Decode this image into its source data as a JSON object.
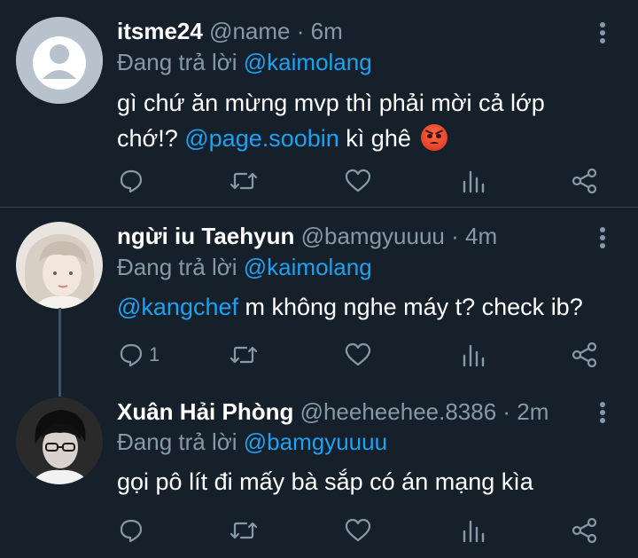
{
  "tweets": [
    {
      "display_name": "itsme24",
      "handle": "@name",
      "time": " · 6m",
      "reply_prefix": "Đang trả lời ",
      "reply_to": "@kaimolang",
      "text_line1": "gì chứ ăn mừng mvp thì phải mời cả lớp",
      "text_line2_a": "chớ!? ",
      "text_mention": "@page.soobin",
      "text_line2_b": " kì ghê ",
      "emoji": "angry-face-emoji",
      "reply_count": ""
    },
    {
      "display_name": "ngừi iu Taehyun",
      "handle": "@bamgyuuuu",
      "time": " · 4m",
      "reply_prefix": "Đang trả lời ",
      "reply_to": "@kaimolang",
      "text_mention": "@kangchef",
      "text_rest": " m không nghe máy t? check ib?",
      "reply_count": "1"
    },
    {
      "display_name": "Xuân Hải Phòng",
      "handle": "@heeheehee.8386",
      "time": " · 2m",
      "reply_prefix": "Đang trả lời ",
      "reply_to": "@bamgyuuuu",
      "text": "gọi pô lít đi mấy bà sắp có án mạng kìa",
      "reply_count": ""
    }
  ],
  "icons": [
    "reply-icon",
    "retweet-icon",
    "like-icon",
    "analytics-icon",
    "share-icon",
    "more-vertical-icon"
  ],
  "colors": {
    "background": "#15202b",
    "secondary_text": "#8899a6",
    "mention": "#1da1f2",
    "divider": "#38444d"
  }
}
